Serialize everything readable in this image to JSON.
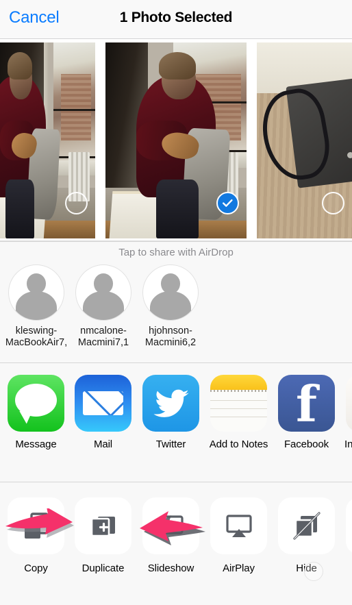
{
  "header": {
    "cancel_label": "Cancel",
    "title": "1 Photo Selected",
    "cancel_color": "#0a7cff"
  },
  "photos": [
    {
      "name": "photo-thumbnail-1",
      "description": "Woman in maroon sweater holding a tote bag by a bright window with radiator",
      "selected": false,
      "badge": "unselected-circle"
    },
    {
      "name": "photo-thumbnail-2",
      "description": "Woman in maroon sweater smiling, holding a tote bag by a window, artwork on floor",
      "selected": true,
      "badge": "selected-checkmark"
    },
    {
      "name": "photo-thumbnail-3",
      "description": "Charcoal felt bag with black strap on a light wood table",
      "selected": false,
      "badge": "unselected-circle"
    }
  ],
  "selection": {
    "check_color": "#1279e0",
    "check_glyph": "checkmark-icon"
  },
  "airdrop": {
    "hint": "Tap to share with AirDrop",
    "contacts": [
      {
        "name": "kleswing-MacBookAir7,",
        "icon": "person-avatar-icon"
      },
      {
        "name": "nmcalone-Macmini7,1",
        "icon": "person-avatar-icon"
      },
      {
        "name": "hjohnson-Macmini6,2",
        "icon": "person-avatar-icon"
      }
    ]
  },
  "apps": [
    {
      "label": "Message",
      "icon": "messages-app-icon",
      "color": "#35d33c"
    },
    {
      "label": "Mail",
      "icon": "mail-app-icon",
      "color": "#2e8cf0"
    },
    {
      "label": "Twitter",
      "icon": "twitter-app-icon",
      "color": "#1e96e6"
    },
    {
      "label": "Add to Notes",
      "icon": "notes-app-icon",
      "color": "#f9c21b"
    },
    {
      "label": "Facebook",
      "icon": "facebook-app-icon",
      "color": "#3a5693"
    },
    {
      "label": "In",
      "icon": "instagram-app-icon",
      "color": "#efece7"
    }
  ],
  "actions": [
    {
      "label": "Copy",
      "icon": "copy-icon"
    },
    {
      "label": "Duplicate",
      "icon": "duplicate-icon"
    },
    {
      "label": "Slideshow",
      "icon": "slideshow-icon"
    },
    {
      "label": "AirPlay",
      "icon": "airplay-icon"
    },
    {
      "label": "Hide",
      "icon": "hide-icon"
    },
    {
      "label": "",
      "icon": "more-actions-icon"
    }
  ],
  "annotations": [
    {
      "name": "pink-arrow-right",
      "direction": "right",
      "color": "#f5316a",
      "target": "Copy"
    },
    {
      "name": "pink-arrow-left",
      "direction": "left",
      "color": "#f5316a",
      "target": "Slideshow"
    }
  ],
  "touch_indicator": {
    "name": "touch-point-indicator",
    "visible": true
  }
}
